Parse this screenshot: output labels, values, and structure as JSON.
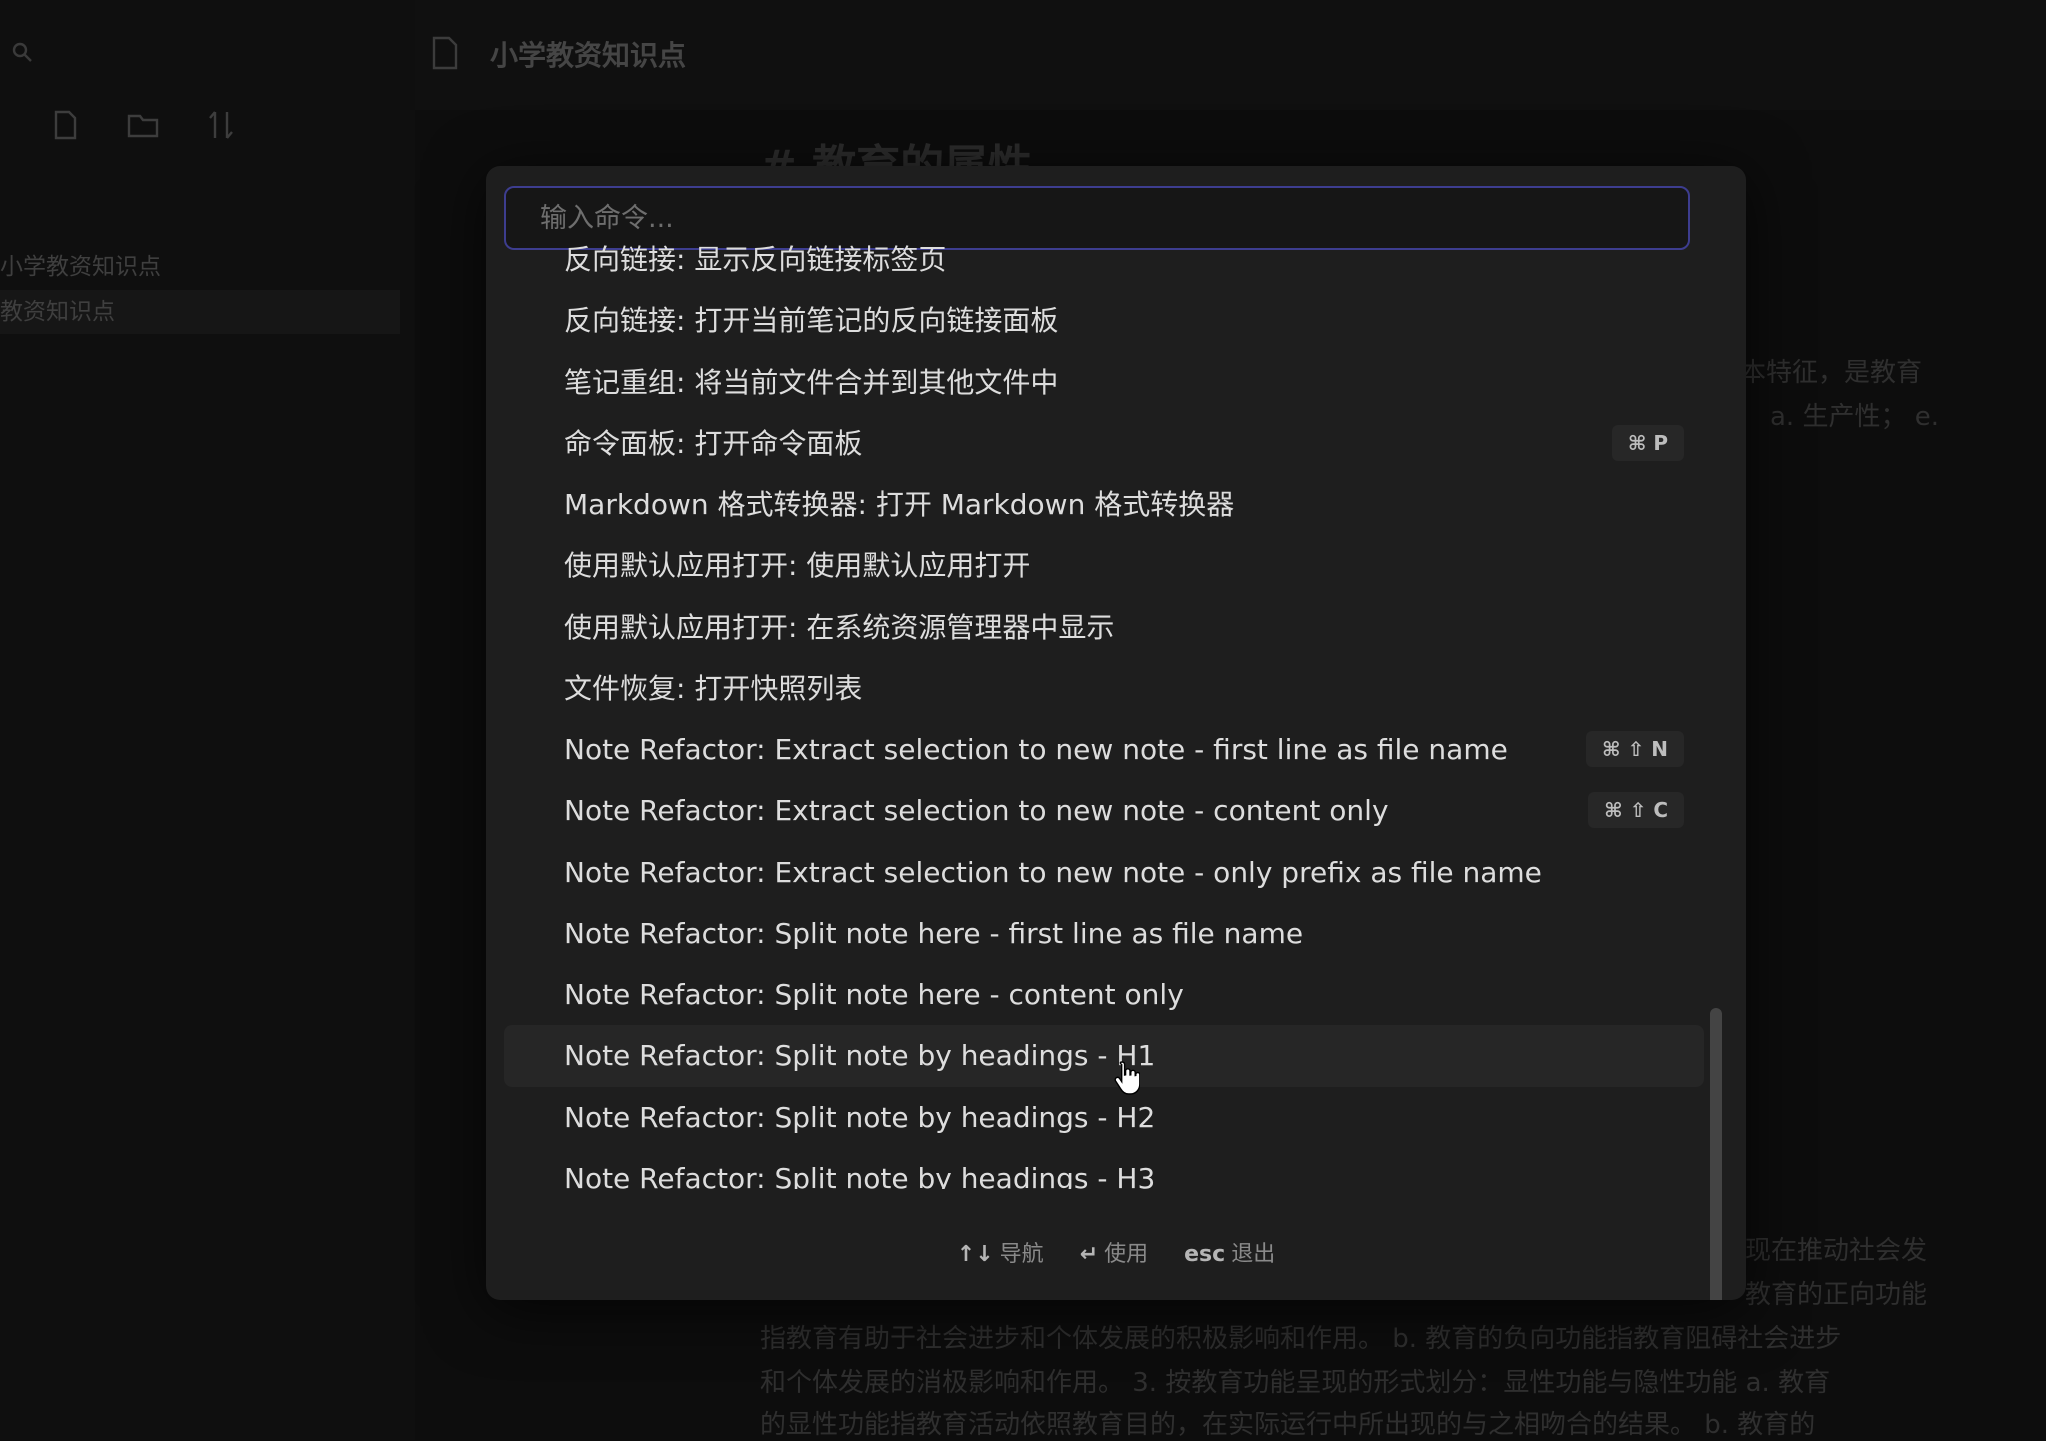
{
  "app": {
    "sidebar": {
      "items": [
        "小学教资知识点",
        "教资知识点"
      ],
      "tool_icons": [
        "new-note-icon",
        "new-folder-icon",
        "sort-icon"
      ]
    },
    "doc": {
      "title": "小学教资知识点",
      "heading": "# 教育的属性",
      "lines": [
        "本特征，是教育",
        "a. 生产性； e.",
        "现在推动社会发",
        "教育的正向功能",
        "指教育有助于社会进步和个体发展的积极影响和作用。 b. 教育的负向功能指教育阻碍社会进步",
        "和个体发展的消极影响和作用。 3. 按教育功能呈现的形式划分：显性功能与隐性功能 a. 教育",
        "的显性功能指教育活动依照教育目的，在实际运行中所出现的与之相吻合的结果。 b. 教育的"
      ]
    }
  },
  "palette": {
    "input_placeholder": "输入命令...",
    "commands": [
      {
        "label": "反向链接: 显示反向链接标签页",
        "hotkey": null
      },
      {
        "label": "反向链接: 打开当前笔记的反向链接面板",
        "hotkey": null
      },
      {
        "label": "笔记重组: 将当前文件合并到其他文件中",
        "hotkey": null
      },
      {
        "label": "命令面板: 打开命令面板",
        "hotkey": "⌘ P"
      },
      {
        "label": "Markdown 格式转换器: 打开 Markdown 格式转换器",
        "hotkey": null
      },
      {
        "label": "使用默认应用打开: 使用默认应用打开",
        "hotkey": null
      },
      {
        "label": "使用默认应用打开: 在系统资源管理器中显示",
        "hotkey": null
      },
      {
        "label": "文件恢复: 打开快照列表",
        "hotkey": null
      },
      {
        "label": "Note Refactor: Extract selection to new note - first line as file name",
        "hotkey": "⌘ ⇧ N"
      },
      {
        "label": "Note Refactor: Extract selection to new note - content only",
        "hotkey": "⌘ ⇧ C"
      },
      {
        "label": "Note Refactor: Extract selection to new note - only prefix as file name",
        "hotkey": null
      },
      {
        "label": "Note Refactor: Split note here - first line as file name",
        "hotkey": null
      },
      {
        "label": "Note Refactor: Split note here - content only",
        "hotkey": null
      },
      {
        "label": "Note Refactor: Split note by headings - H1",
        "hotkey": null
      },
      {
        "label": "Note Refactor: Split note by headings - H2",
        "hotkey": null
      },
      {
        "label": "Note Refactor: Split note by headings - H3",
        "hotkey": null
      }
    ],
    "selected_index": 13,
    "footer": [
      {
        "key": "↑↓",
        "label": "导航"
      },
      {
        "key": "↵",
        "label": "使用"
      },
      {
        "key": "esc",
        "label": "退出"
      }
    ]
  }
}
